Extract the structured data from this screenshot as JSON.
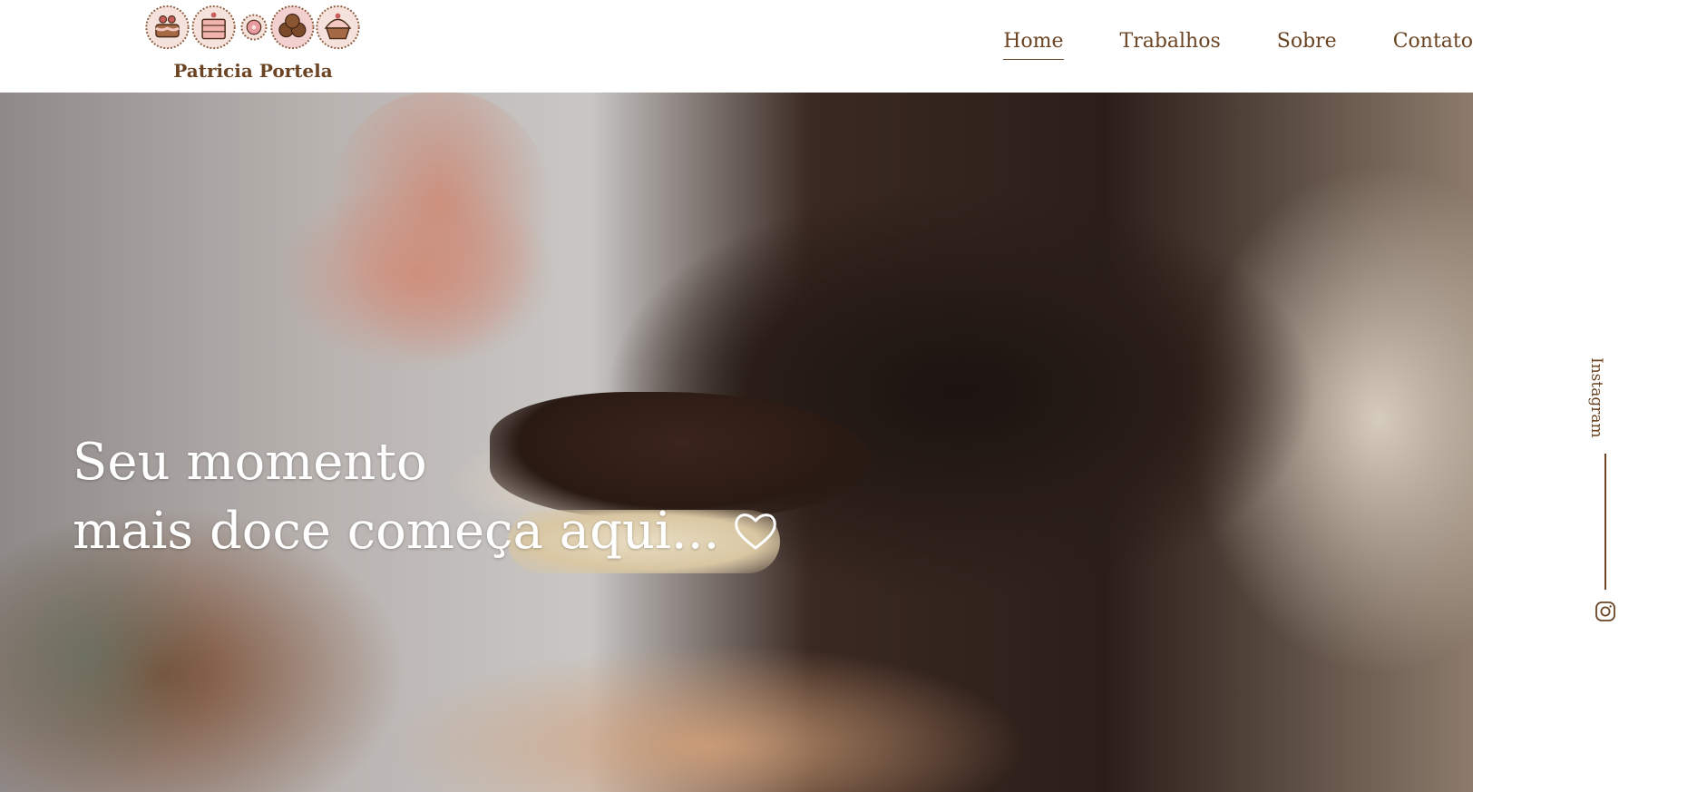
{
  "brand": {
    "name": "Patricia Portela",
    "logo_icons": [
      "cake-icon",
      "layer-cake-icon",
      "donut-icon",
      "cookies-icon",
      "cupcake-icon"
    ]
  },
  "nav": {
    "items": [
      {
        "label": "Home",
        "active": true
      },
      {
        "label": "Trabalhos",
        "active": false
      },
      {
        "label": "Sobre",
        "active": false
      },
      {
        "label": "Contato",
        "active": false
      }
    ]
  },
  "hero": {
    "title_line1": "Seu momento",
    "title_line2": "mais doce começa aqui...",
    "icon": "heart-outline-icon"
  },
  "social": {
    "label": "Instagram",
    "icon": "instagram-icon"
  },
  "colors": {
    "brand_brown": "#6b4423",
    "hero_text": "#ffffff",
    "logo_bg": "#f6e2dc"
  }
}
